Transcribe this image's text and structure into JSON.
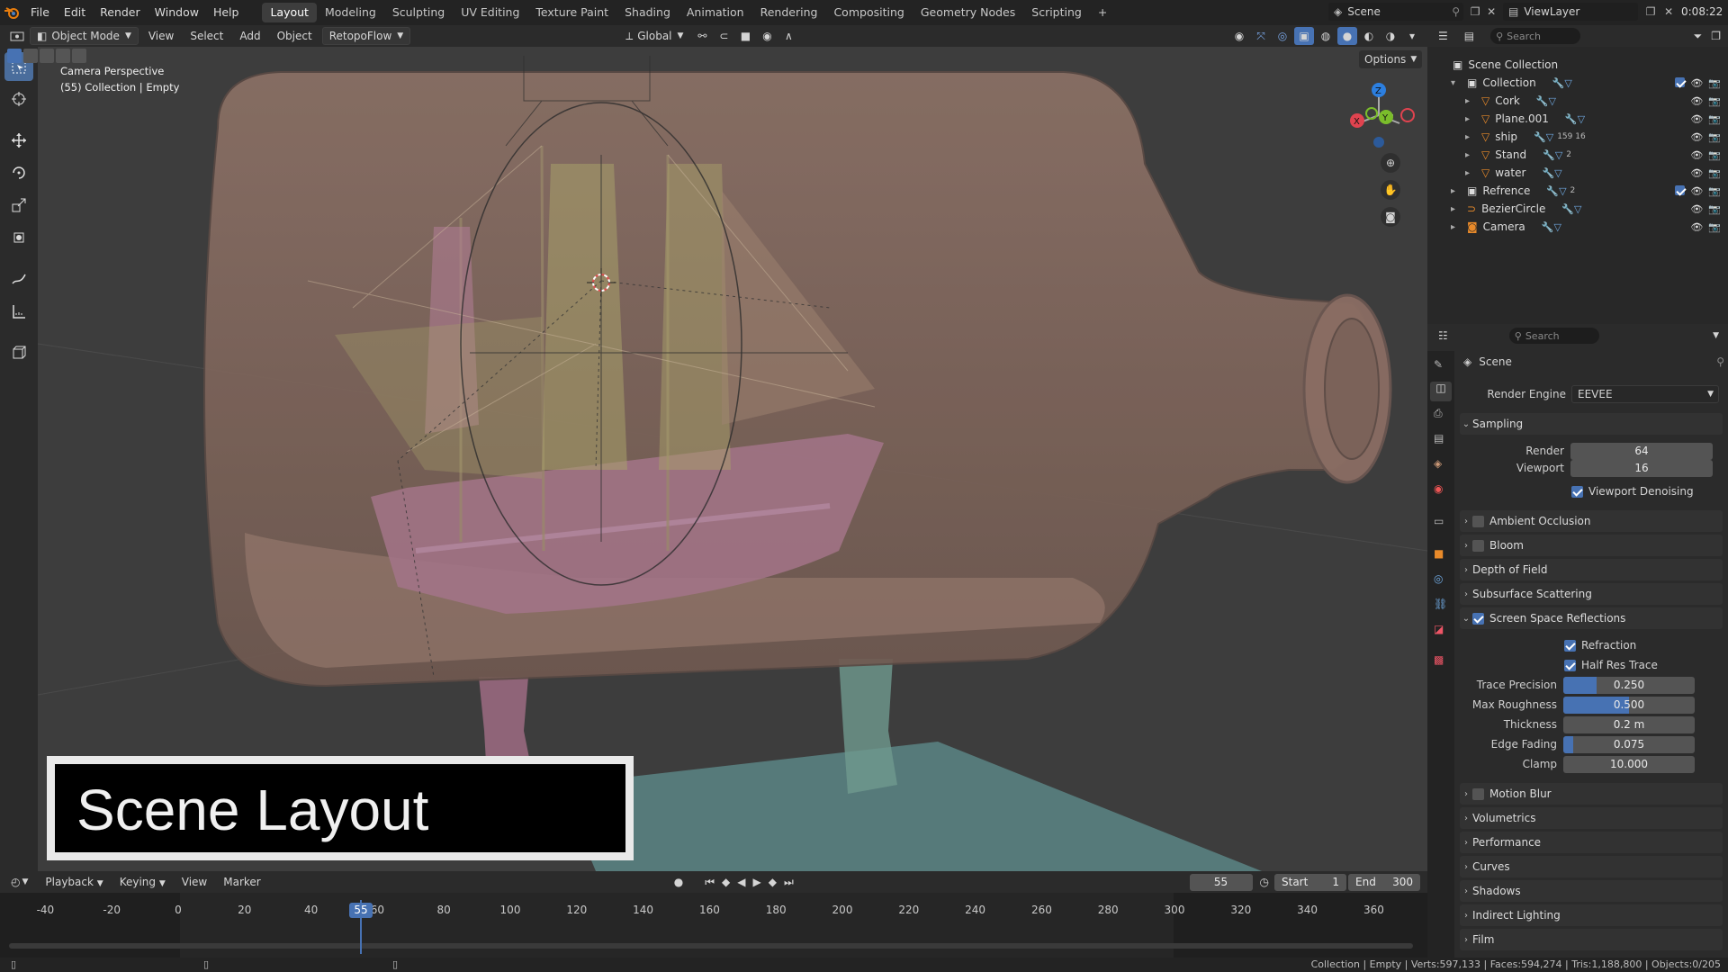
{
  "menu": {
    "items": [
      "File",
      "Edit",
      "Render",
      "Window",
      "Help"
    ],
    "workspaces": [
      "Layout",
      "Modeling",
      "Sculpting",
      "UV Editing",
      "Texture Paint",
      "Shading",
      "Animation",
      "Rendering",
      "Compositing",
      "Geometry Nodes",
      "Scripting"
    ],
    "active_workspace": "Layout",
    "add_tab": "+",
    "scene_name": "Scene",
    "view_layer": "ViewLayer",
    "clock": "0:08:22"
  },
  "viewport_header": {
    "mode": "Object Mode",
    "menus": [
      "View",
      "Select",
      "Add",
      "Object"
    ],
    "addon": "RetopoFlow",
    "transform_orientation": "Global",
    "options": "Options"
  },
  "viewport": {
    "camera_label": "Camera Perspective",
    "collection_label": "(55) Collection | Empty",
    "title_overlay": "Scene Layout",
    "gizmo": {
      "x": "X",
      "y": "Y",
      "z": "Z"
    }
  },
  "outliner": {
    "search_placeholder": "Search",
    "root": "Scene Collection",
    "items": [
      {
        "name": "Collection",
        "level": 1,
        "extra": ""
      },
      {
        "name": "Cork",
        "level": 2,
        "extra": ""
      },
      {
        "name": "Plane.001",
        "level": 2,
        "extra": ""
      },
      {
        "name": "ship",
        "level": 2,
        "extra": "159 16"
      },
      {
        "name": "Stand",
        "level": 2,
        "extra": "2"
      },
      {
        "name": "water",
        "level": 2,
        "extra": ""
      },
      {
        "name": "Refrence",
        "level": 1,
        "extra": "2"
      },
      {
        "name": "BezierCircle",
        "level": 1,
        "extra": ""
      },
      {
        "name": "Camera",
        "level": 1,
        "extra": ""
      }
    ]
  },
  "properties": {
    "search_placeholder": "Search",
    "context": "Scene",
    "render_engine_label": "Render Engine",
    "render_engine": "EEVEE",
    "sampling": {
      "title": "Sampling",
      "render_label": "Render",
      "render": "64",
      "viewport_label": "Viewport",
      "viewport": "16",
      "denoise_label": "Viewport Denoising"
    },
    "panels_a": [
      "Ambient Occlusion",
      "Bloom",
      "Depth of Field",
      "Subsurface Scattering"
    ],
    "ssr": {
      "title": "Screen Space Reflections",
      "refraction": "Refraction",
      "half_res": "Half Res Trace",
      "trace_precision_label": "Trace Precision",
      "trace_precision": "0.250",
      "trace_precision_frac": 0.25,
      "max_roughness_label": "Max Roughness",
      "max_roughness": "0.500",
      "max_roughness_frac": 0.5,
      "thickness_label": "Thickness",
      "thickness": "0.2 m",
      "edge_fading_label": "Edge Fading",
      "edge_fading": "0.075",
      "edge_fading_frac": 0.075,
      "clamp_label": "Clamp",
      "clamp": "10.000"
    },
    "panels_b": [
      "Motion Blur",
      "Volumetrics",
      "Performance",
      "Curves",
      "Shadows",
      "Indirect Lighting",
      "Film"
    ]
  },
  "timeline": {
    "menus": [
      "Playback",
      "Keying",
      "View",
      "Marker"
    ],
    "current_frame": "55",
    "start_label": "Start",
    "start": "1",
    "end_label": "End",
    "end": "300",
    "ticks": [
      "-40",
      "-20",
      "0",
      "20",
      "40",
      "60",
      "80",
      "100",
      "120",
      "140",
      "160",
      "180",
      "200",
      "220",
      "240",
      "260",
      "280",
      "300",
      "320",
      "340",
      "360"
    ],
    "playhead": "55"
  },
  "status": {
    "text": "Collection | Empty | Verts:597,133 | Faces:594,274 | Tris:1,188,800 | Objects:0/205"
  },
  "colors": {
    "accent": "#4772b3",
    "active_tool": "#4a6d9c",
    "bottle": "#8a6f63",
    "water": "#5c8a8a"
  }
}
